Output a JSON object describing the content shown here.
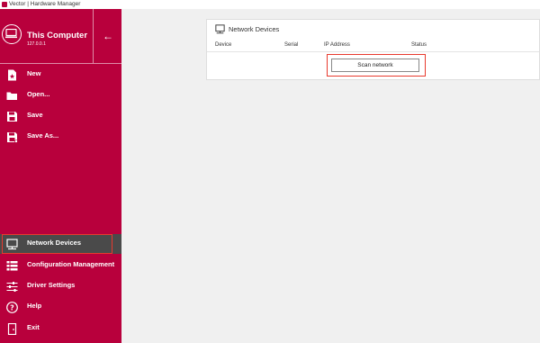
{
  "window": {
    "title": "Vector | Hardware Manager"
  },
  "computer": {
    "name": "This Computer",
    "ip": "127.0.0.1"
  },
  "menu": [
    {
      "label": "New",
      "icon": "new-file-icon"
    },
    {
      "label": "Open...",
      "icon": "folder-icon"
    },
    {
      "label": "Save",
      "icon": "save-icon"
    },
    {
      "label": "Save As...",
      "icon": "save-as-icon"
    }
  ],
  "nav": [
    {
      "label": "Network Devices",
      "icon": "network-icon",
      "active": true
    },
    {
      "label": "Configuration Management",
      "icon": "configuration-icon"
    },
    {
      "label": "Driver Settings",
      "icon": "sliders-icon"
    },
    {
      "label": "Help",
      "icon": "help-icon"
    },
    {
      "label": "Exit",
      "icon": "exit-icon"
    }
  ],
  "panel": {
    "title": "Network Devices",
    "columns": [
      "Device",
      "Serial",
      "IP Address",
      "Status"
    ],
    "scan_label": "Scan network"
  },
  "colors": {
    "accent": "#b8003c",
    "active_bg": "#4a4a4a",
    "highlight": "#e83a2e"
  }
}
